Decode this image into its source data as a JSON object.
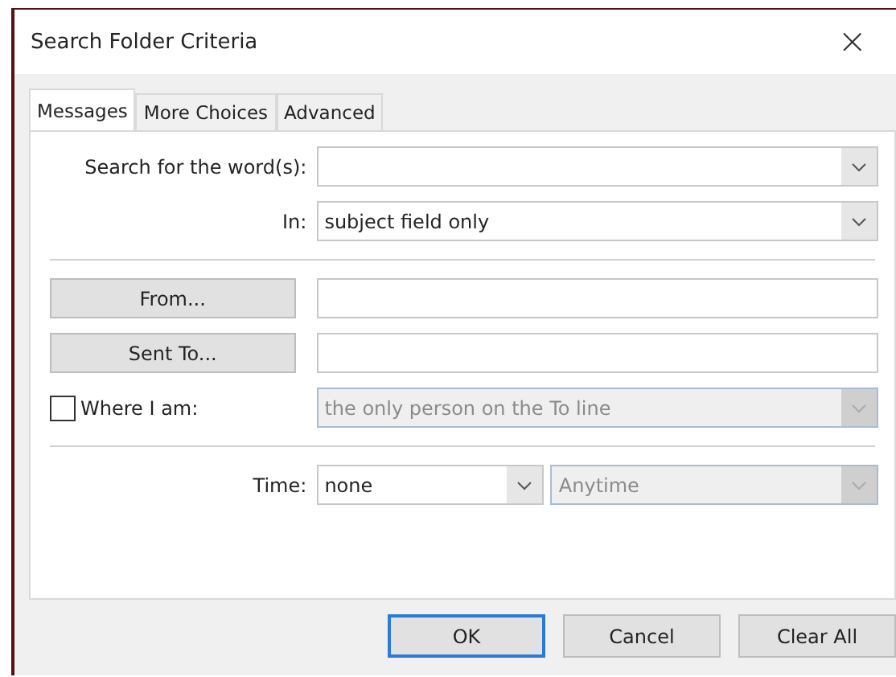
{
  "window": {
    "title": "Search Folder Criteria",
    "close": "×"
  },
  "tabs": [
    {
      "label": "Messages",
      "selected": true
    },
    {
      "label": "More Choices",
      "selected": false
    },
    {
      "label": "Advanced",
      "selected": false
    }
  ],
  "search": {
    "label": "Search for the word(s):"
  },
  "in": {
    "label": "In:",
    "value": "subject field only"
  },
  "from": {
    "button": "From..."
  },
  "sent_to": {
    "button": "Sent To..."
  },
  "where": {
    "label": "Where I am:",
    "checked": false,
    "value": "the only person on the To line",
    "disabled": true
  },
  "time": {
    "label": "Time:",
    "value": "none",
    "range": "Anytime",
    "range_disabled": true
  },
  "buttons": [
    {
      "label": "OK",
      "default": true
    },
    {
      "label": "Cancel",
      "default": false
    },
    {
      "label": "Clear All",
      "default": false
    }
  ]
}
